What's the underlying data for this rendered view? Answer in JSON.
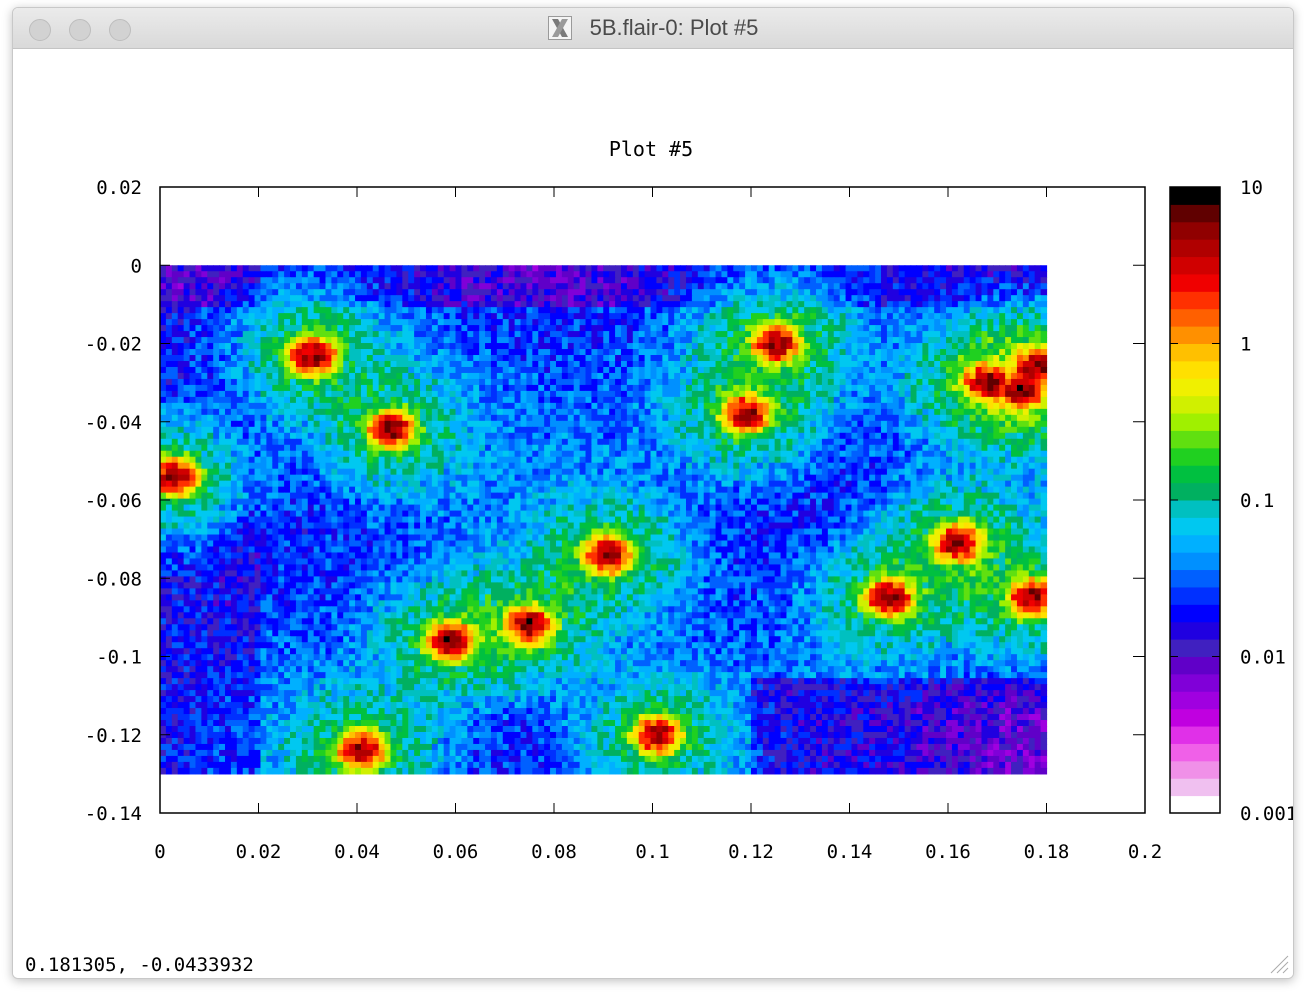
{
  "window": {
    "title": "5B.flair-0: Plot #5",
    "app_icon": "x11-icon"
  },
  "coords_readout": "0.181305, -0.0433932",
  "chart_data": {
    "type": "heatmap",
    "title": "Plot #5",
    "xlabel": "",
    "ylabel": "",
    "xlim": [
      0,
      0.2
    ],
    "ylim": [
      -0.14,
      0.02
    ],
    "data_extent": {
      "x": [
        0,
        0.18
      ],
      "y": [
        -0.13,
        0
      ]
    },
    "x_ticks": [
      "0",
      "0.02",
      "0.04",
      "0.06",
      "0.08",
      "0.1",
      "0.12",
      "0.14",
      "0.16",
      "0.18",
      "0.2"
    ],
    "y_ticks": [
      "0.02",
      "0",
      "-0.02",
      "-0.04",
      "-0.06",
      "-0.08",
      "-0.1",
      "-0.12",
      "-0.14"
    ],
    "colorbar": {
      "scale": "log",
      "range": [
        0.001,
        10
      ],
      "ticks": [
        "10",
        "1",
        "0.1",
        "0.01",
        "0.001"
      ],
      "colors": [
        "#ffffff",
        "#f0c0f0",
        "#f090e8",
        "#f060e8",
        "#e030e8",
        "#c000e0",
        "#a000e0",
        "#8000d8",
        "#6000c8",
        "#4020c0",
        "#2000e0",
        "#0000ff",
        "#0030ff",
        "#0060ff",
        "#0090ff",
        "#00b0ff",
        "#00c8f0",
        "#00c0c0",
        "#00b060",
        "#00c040",
        "#20d020",
        "#60e010",
        "#a0f000",
        "#d0f000",
        "#f0f000",
        "#ffe000",
        "#ffc000",
        "#ff9000",
        "#ff6000",
        "#ff3000",
        "#f00000",
        "#d00000",
        "#b00000",
        "#900000",
        "#600000",
        "#000000"
      ]
    },
    "hotspots": [
      {
        "x": 0.031,
        "y": -0.023,
        "value": 5
      },
      {
        "x": 0.047,
        "y": -0.042,
        "value": 5
      },
      {
        "x": 0.003,
        "y": -0.054,
        "value": 5
      },
      {
        "x": 0.125,
        "y": -0.02,
        "value": 5
      },
      {
        "x": 0.119,
        "y": -0.038,
        "value": 5
      },
      {
        "x": 0.168,
        "y": -0.03,
        "value": 5
      },
      {
        "x": 0.175,
        "y": -0.032,
        "value": 5
      },
      {
        "x": 0.178,
        "y": -0.026,
        "value": 5
      },
      {
        "x": 0.091,
        "y": -0.074,
        "value": 5
      },
      {
        "x": 0.059,
        "y": -0.096,
        "value": 5
      },
      {
        "x": 0.075,
        "y": -0.092,
        "value": 5
      },
      {
        "x": 0.041,
        "y": -0.124,
        "value": 5
      },
      {
        "x": 0.101,
        "y": -0.12,
        "value": 5
      },
      {
        "x": 0.148,
        "y": -0.085,
        "value": 5
      },
      {
        "x": 0.162,
        "y": -0.071,
        "value": 5
      },
      {
        "x": 0.177,
        "y": -0.085,
        "value": 5
      }
    ]
  }
}
